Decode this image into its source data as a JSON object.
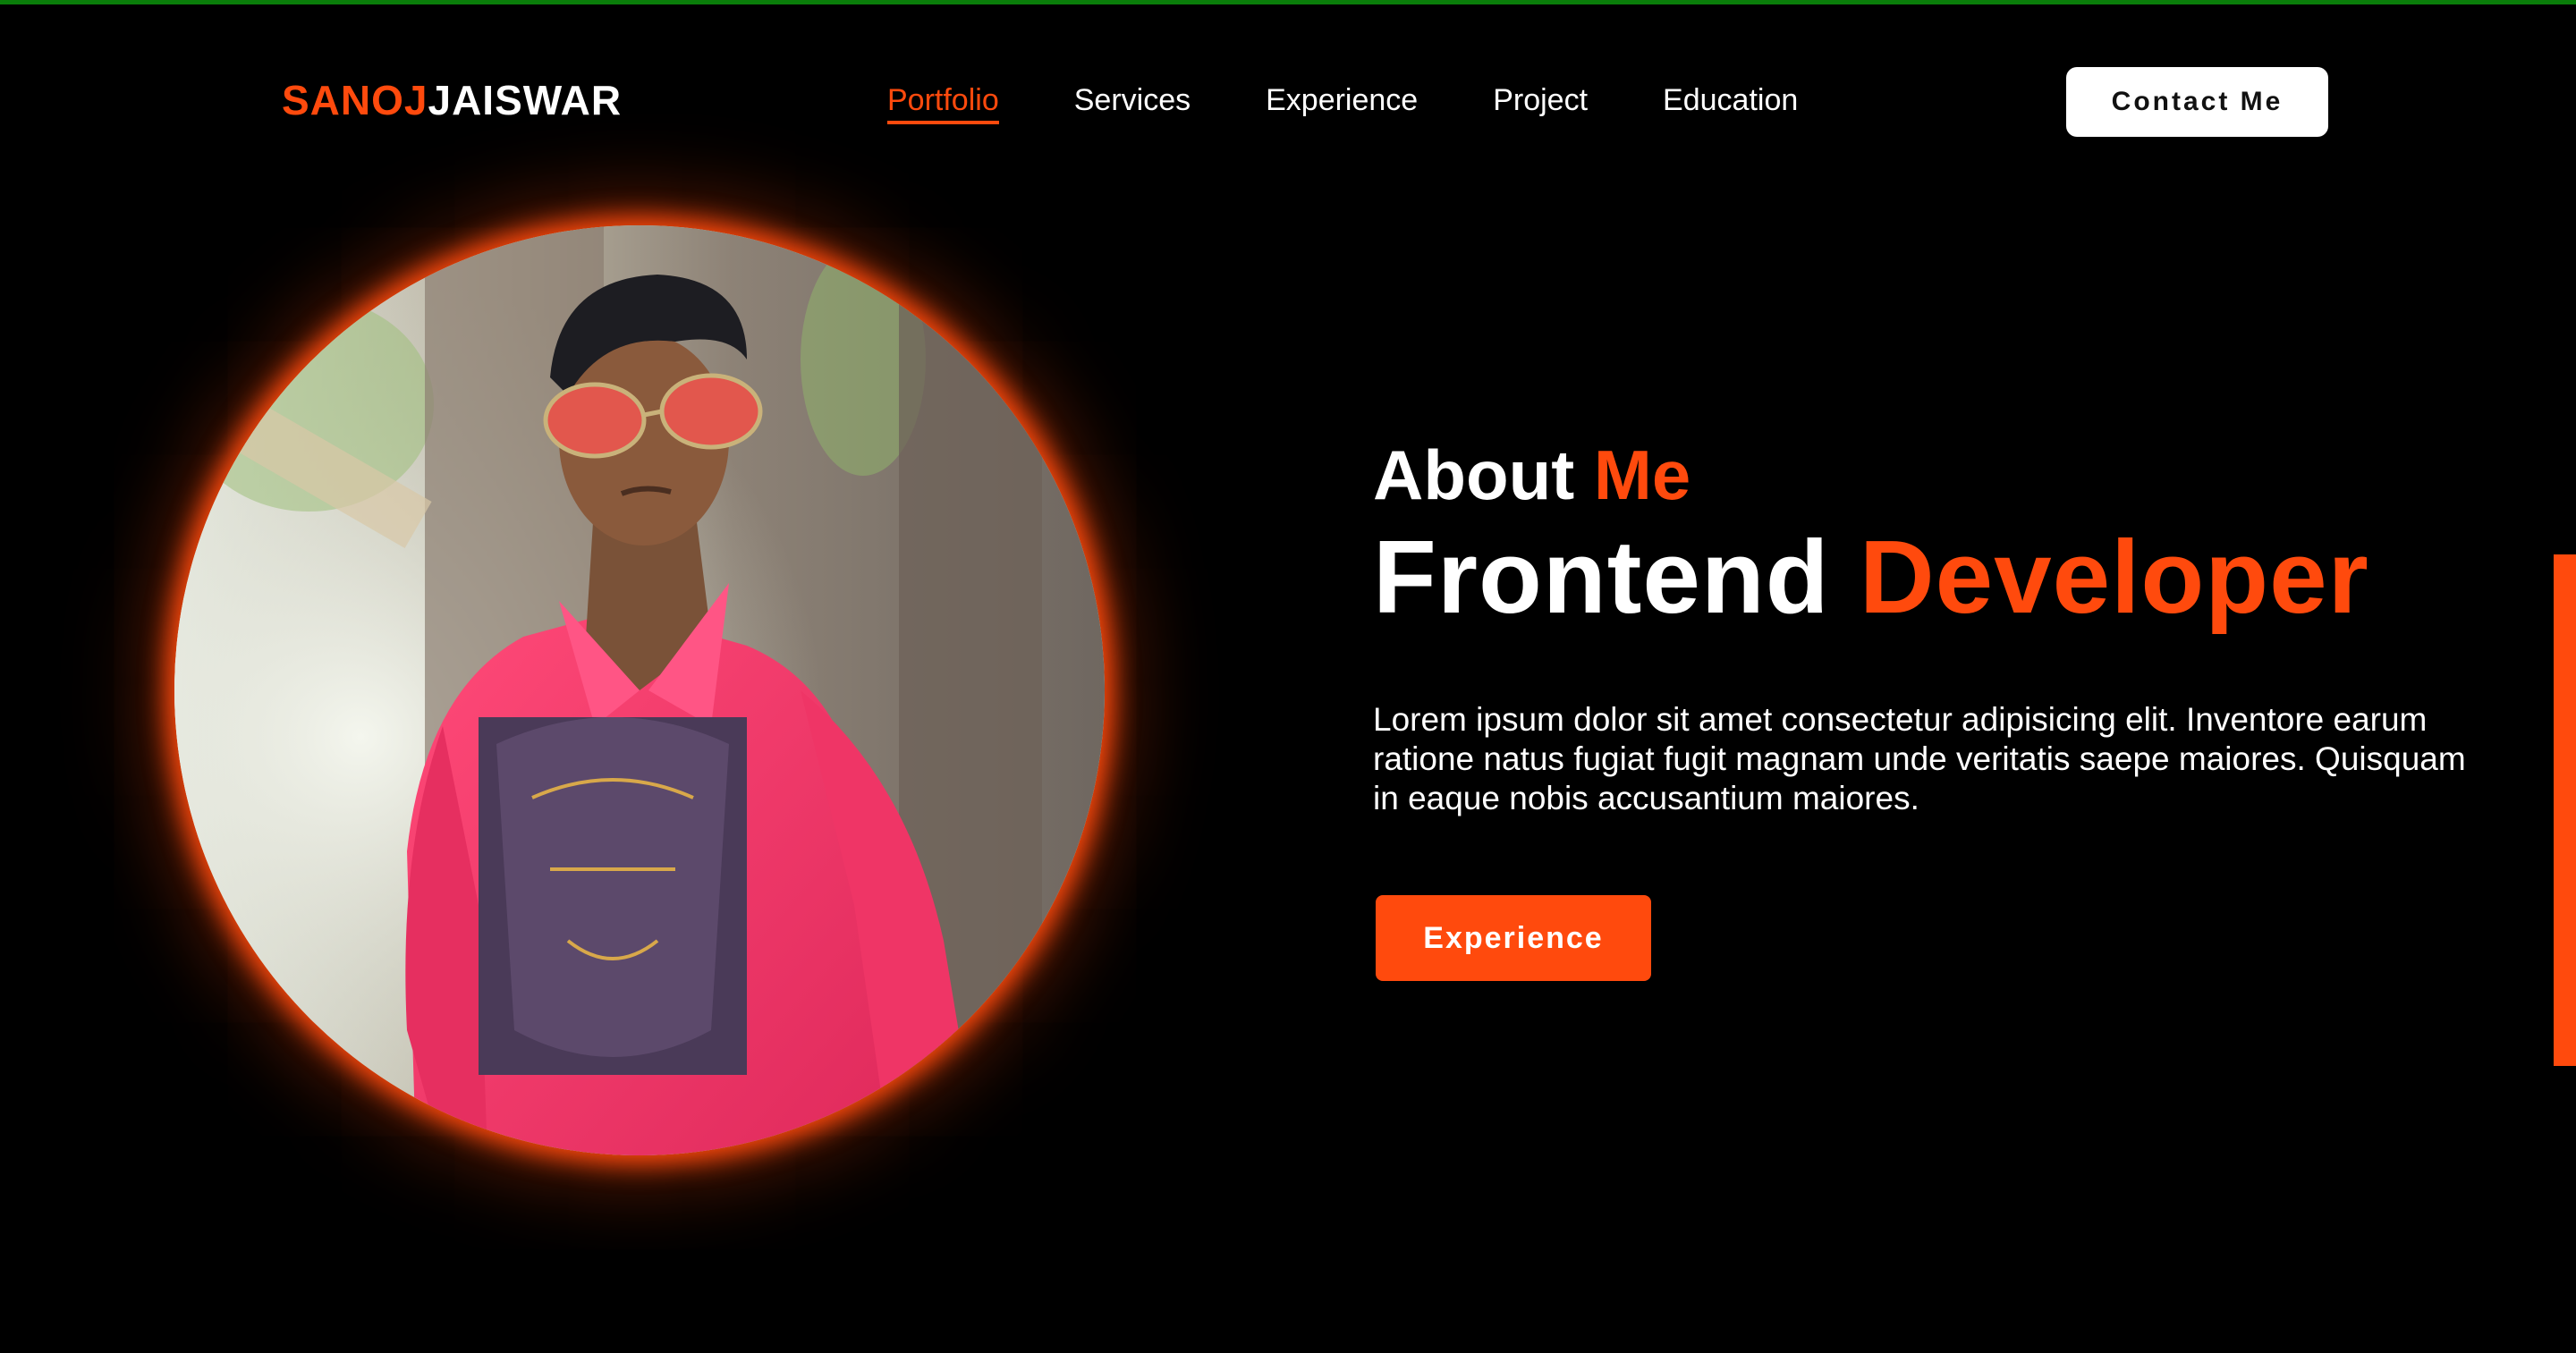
{
  "header": {
    "logo_accent": "SANOJ",
    "logo_rest": "JAISWAR",
    "nav": [
      {
        "label": "Portfolio",
        "active": true
      },
      {
        "label": "Services",
        "active": false
      },
      {
        "label": "Experience",
        "active": false
      },
      {
        "label": "Project",
        "active": false
      },
      {
        "label": "Education",
        "active": false
      }
    ],
    "contact_label": "Contact Me"
  },
  "hero": {
    "about_plain": "About",
    "about_accent": "Me",
    "role_plain": "Frontend",
    "role_accent": "Developer",
    "description": "Lorem ipsum dolor sit amet consectetur adipisicing elit. Inventore earum ratione natus fugiat fugit magnam unde veritatis saepe maiores. Quisquam in eaque nobis accusantium maiores.",
    "cta_label": "Experience",
    "portrait_alt": "Portrait photo"
  },
  "colors": {
    "accent": "#ff4a0d",
    "background": "#000000",
    "top_bar": "#0a7d0a",
    "text": "#ffffff"
  },
  "icons": {
    "portrait": "person-photo"
  }
}
